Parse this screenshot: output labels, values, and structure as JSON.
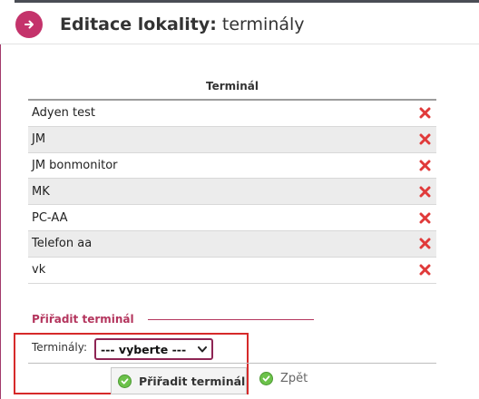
{
  "header": {
    "title_bold": "Editace lokality:",
    "title_rest": " terminály",
    "back_icon": "arrow-right-icon",
    "accent": "#c4336b"
  },
  "table": {
    "column_header": "Terminál",
    "rows": [
      {
        "name": "Adyen test"
      },
      {
        "name": "JM"
      },
      {
        "name": "JM bonmonitor"
      },
      {
        "name": "MK"
      },
      {
        "name": "PC-AA"
      },
      {
        "name": "Telefon aa"
      },
      {
        "name": "vk"
      }
    ],
    "delete_icon": "red-x-icon",
    "delete_color": "#e03a3a"
  },
  "assign": {
    "section_title": "Přiřadit terminál",
    "field_label": "Terminály:",
    "select_value": "--- vyberte ---",
    "submit_label": "Přiřadit terminál",
    "back_label": "Zpět"
  }
}
